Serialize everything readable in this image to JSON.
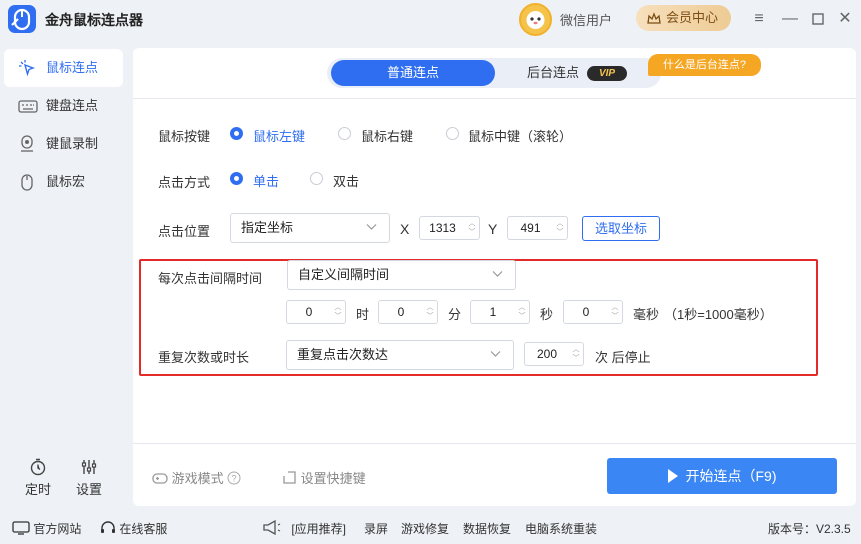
{
  "app": {
    "title": "金舟鼠标连点器",
    "user": "微信用户",
    "vip_center": "会员中心"
  },
  "sidebar": {
    "items": [
      {
        "label": "鼠标连点",
        "icon": "click-icon",
        "active": true
      },
      {
        "label": "键盘连点",
        "icon": "keyboard-icon",
        "active": false
      },
      {
        "label": "键鼠录制",
        "icon": "record-icon",
        "active": false
      },
      {
        "label": "鼠标宏",
        "icon": "mouse-icon",
        "active": false
      }
    ],
    "timer": "定时",
    "settings": "设置"
  },
  "tabs": {
    "normal": "普通连点",
    "background": "后台连点",
    "vip_badge": "VIP",
    "what_is": "什么是后台连点?"
  },
  "form": {
    "mouse_button": {
      "label": "鼠标按键",
      "options": [
        "鼠标左键",
        "鼠标右键",
        "鼠标中键（滚轮）"
      ],
      "selected": 0
    },
    "click_mode": {
      "label": "点击方式",
      "options": [
        "单击",
        "双击"
      ],
      "selected": 0
    },
    "position": {
      "label": "点击位置",
      "select": "指定坐标",
      "x_label": "X",
      "x": "1313",
      "y_label": "Y",
      "y": "491",
      "pick": "选取坐标"
    },
    "interval": {
      "label": "每次点击间隔时间",
      "select": "自定义间隔时间",
      "hours": "0",
      "hours_unit": "时",
      "minutes": "0",
      "minutes_unit": "分",
      "seconds": "1",
      "seconds_unit": "秒",
      "ms": "0",
      "ms_unit": "毫秒",
      "note": "（1秒=1000毫秒）"
    },
    "repeat": {
      "label": "重复次数或时长",
      "select": "重复点击次数达",
      "count": "200",
      "suffix": "次 后停止"
    }
  },
  "bottom": {
    "game_mode": "游戏模式",
    "hotkey": "设置快捷键",
    "start": "开始连点（F9)"
  },
  "footer": {
    "website": "官方网站",
    "support": "在线客服",
    "recommend": "[应用推荐]",
    "links": [
      "录屏",
      "游戏修复",
      "数据恢复",
      "电脑系统重装"
    ],
    "version": "版本号：V2.3.5"
  },
  "colors": {
    "accent": "#2f6ef0",
    "start_button": "#3b86f5",
    "highlight_border": "#e52a2a",
    "vip_orange": "#f5a623"
  }
}
